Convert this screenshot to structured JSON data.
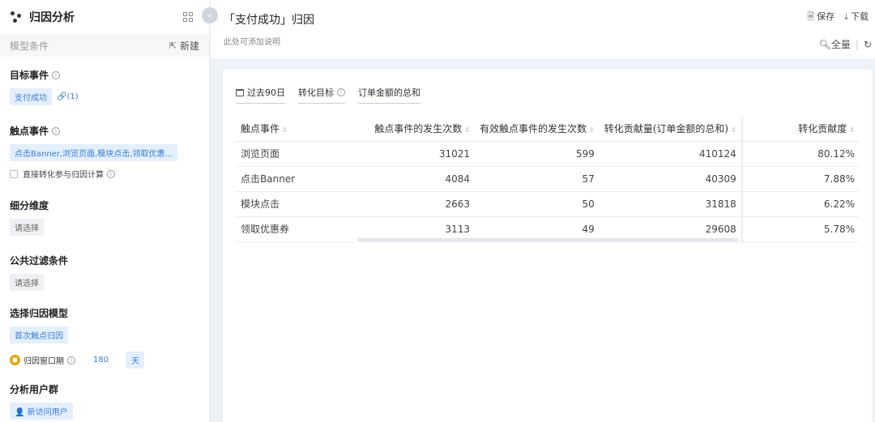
{
  "sidebar": {
    "title": "归因分析",
    "model_conditions_label": "模型条件",
    "new_label": "新建",
    "target_event": {
      "title": "目标事件",
      "tag": "支付成功",
      "link_count": "(1)"
    },
    "touch_event": {
      "title": "触点事件",
      "tag": "点击Banner,浏览页面,模块点击,领取优惠...",
      "checkbox_label": "直接转化参与归因计算"
    },
    "breakdown": {
      "title": "细分维度",
      "placeholder": "请选择"
    },
    "filter": {
      "title": "公共过滤条件",
      "placeholder": "请选择"
    },
    "model": {
      "title": "选择归因模型",
      "tag": "首次触点归因",
      "window_label": "归因窗口期",
      "window_value": "180",
      "window_unit": "天"
    },
    "user_group": {
      "title": "分析用户群",
      "tag": "新访问用户"
    }
  },
  "header": {
    "title": "「支付成功」归因",
    "description": "此处可添加说明",
    "save_label": "保存",
    "download_label": "下载",
    "fullscreen_label": "全量"
  },
  "filters": {
    "date_range": "过去90日",
    "conversion_goal": "转化目标",
    "metric": "订单金额的总和"
  },
  "table": {
    "columns": [
      "触点事件",
      "触点事件的发生次数",
      "有效触点事件的发生次数",
      "转化贡献量(订单金额的总和)",
      "转化贡献度"
    ],
    "rows": [
      [
        "浏览页面",
        "31021",
        "599",
        "410124",
        "80.12%"
      ],
      [
        "点击Banner",
        "4084",
        "57",
        "40309",
        "7.88%"
      ],
      [
        "模块点击",
        "2663",
        "50",
        "31818",
        "6.22%"
      ],
      [
        "领取优惠券",
        "3113",
        "49",
        "29608",
        "5.78%"
      ]
    ]
  },
  "colors": {
    "accent": "#3b7cd6",
    "tag_bg": "#e3effc"
  }
}
